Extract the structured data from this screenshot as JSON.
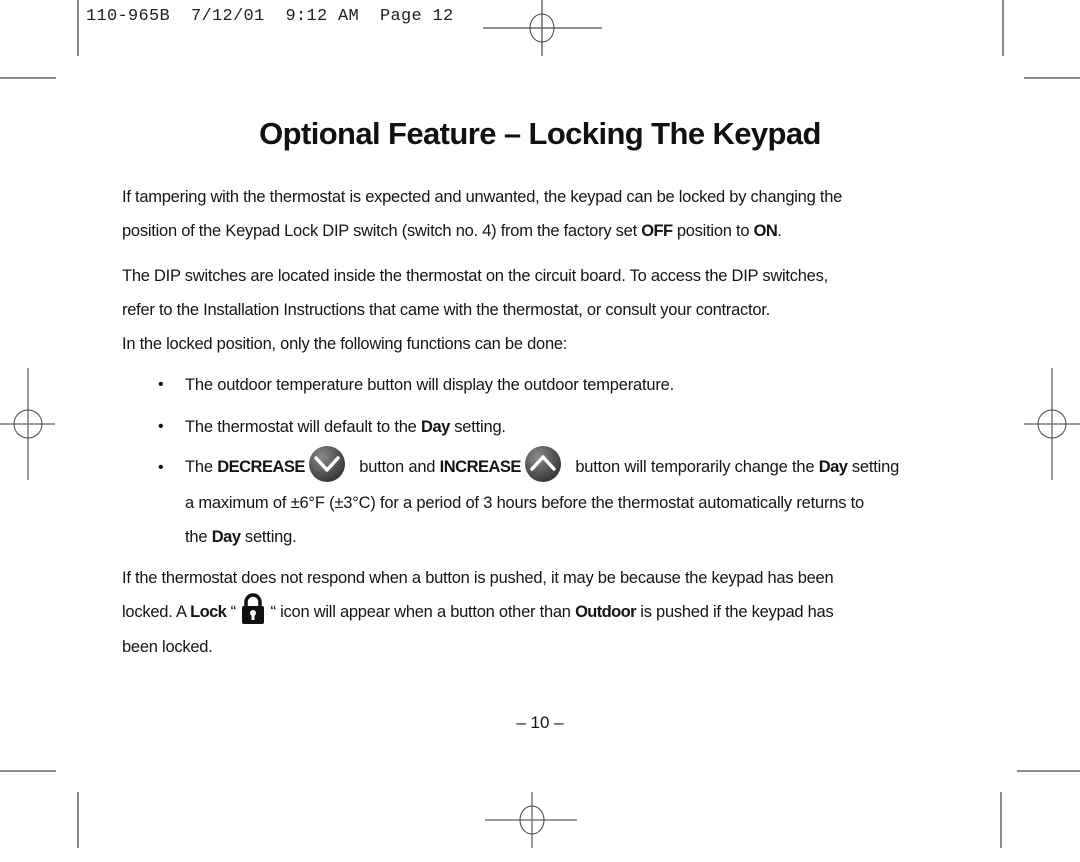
{
  "slug_line": "110-965B  7/12/01  9:12 AM  Page 12",
  "title": "Optional Feature – Locking The Keypad",
  "intro": {
    "line1": "If tampering with the thermostat is expected and unwanted, the keypad can be locked by changing the",
    "line2_a": "position of the Keypad Lock DIP switch (switch no. 4) from the factory set ",
    "line2_off": "OFF",
    "line2_b": " position to ",
    "line2_on": "ON",
    "line2_c": "."
  },
  "dip": {
    "line1": "The DIP switches are located inside the thermostat on the circuit board. To access the DIP switches,",
    "line2": "refer to the Installation Instructions that came with the thermostat, or consult your contractor."
  },
  "locked_intro": "In the locked position, only the following functions can be done:",
  "bullet_char": "•",
  "bullets": {
    "b1": "The outdoor temperature button will display the outdoor temperature.",
    "b2_a": "The thermostat will default to the ",
    "b2_day": "Day",
    "b2_b": " setting.",
    "b3_a": "The ",
    "b3_decrease": "DECREASE",
    "b3_b": " button and ",
    "b3_increase": "INCREASE",
    "b3_c": " button will temporarily change the ",
    "b3_day": "Day",
    "b3_d": " setting",
    "b3_line2": "a maximum of ±6°F (±3°C) for a period of 3 hours before the thermostat automatically returns to",
    "b3_line3_a": "the ",
    "b3_line3_day": "Day",
    "b3_line3_b": " setting."
  },
  "noresponse": {
    "line1": "If the thermostat does not respond when a button is pushed, it may be because the keypad has been",
    "line2_a": "locked. A ",
    "line2_lock": "Lock",
    "line2_b": " “ ",
    "line2_c": " “ icon will appear when a button other than ",
    "line2_outdoor": "Outdoor",
    "line2_d": " is pushed if the keypad has",
    "line3": "been locked."
  },
  "icons": {
    "decrease": "chevron-down-button-icon",
    "increase": "chevron-up-button-icon",
    "lock": "padlock-icon",
    "registration": "registration-crosshair-icon"
  },
  "page_number": "– 10 –"
}
